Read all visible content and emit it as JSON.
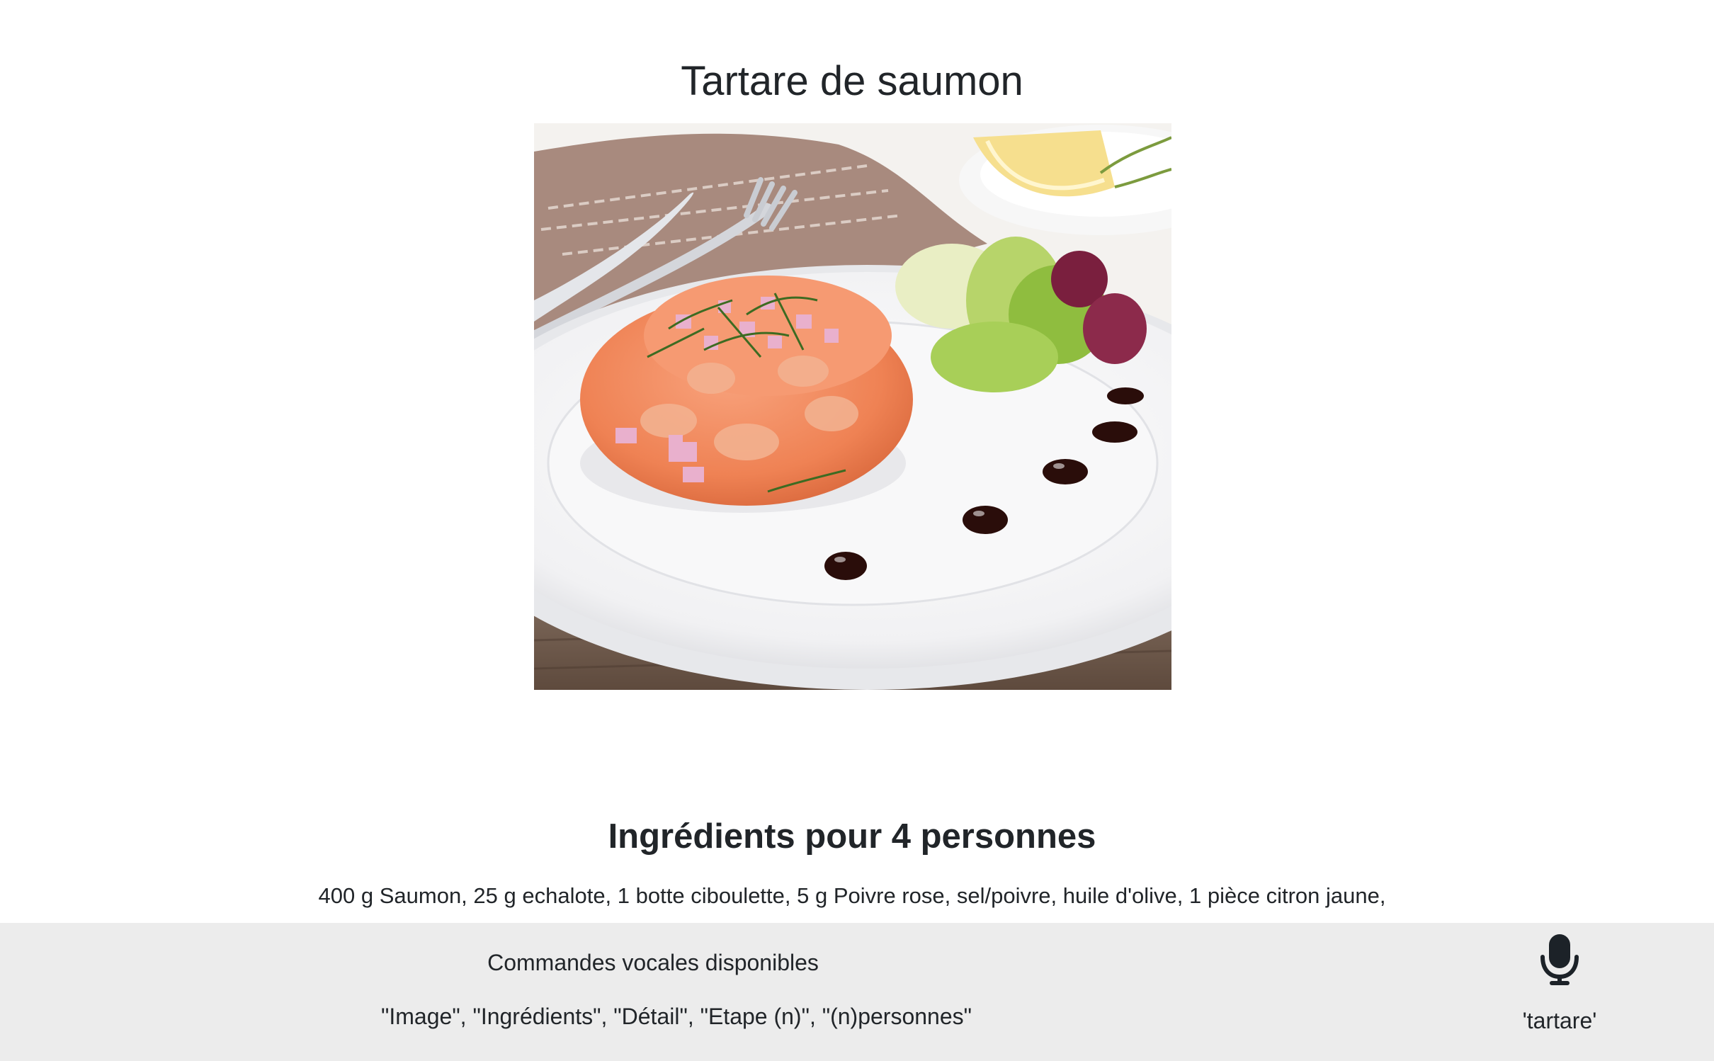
{
  "recipe": {
    "title": "Tartare de saumon",
    "image_alt": "Tartare de saumon"
  },
  "ingredients": {
    "heading": "Ingrédients pour 4 personnes",
    "list": "400 g Saumon, 25 g echalote, 1 botte ciboulette, 5 g Poivre rose, sel/poivre, huile d'olive, 1 pièce citron jaune,"
  },
  "voice": {
    "title": "Commandes vocales disponibles",
    "commands": "\"Image\", \"Ingrédients\", \"Détail\", \"Etape (n)\", \"(n)personnes\"",
    "recognized": "'tartare'",
    "mic_icon": "microphone-icon"
  },
  "colors": {
    "footer_bg": "#ececec",
    "text": "#212529",
    "mic": "#1c2228"
  }
}
